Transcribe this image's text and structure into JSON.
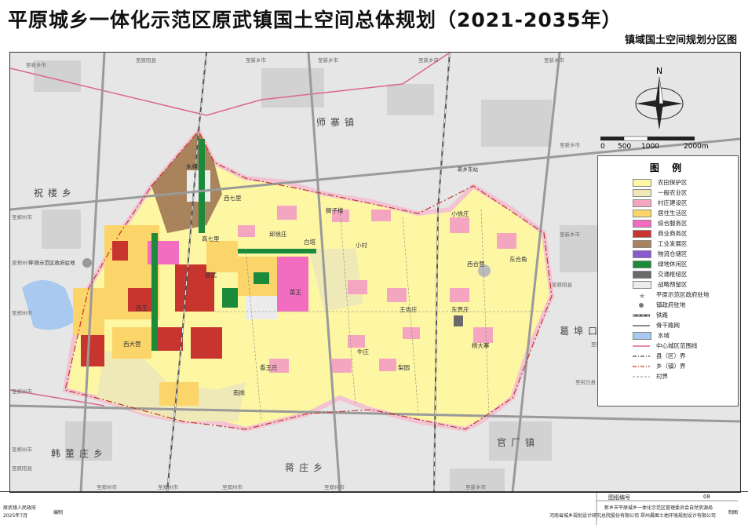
{
  "title": "平原城乡一体化示范区原武镇国土空间总体规划（2021-2035年）",
  "subtitle": "镇域国土空间规划分区图",
  "north_label": "N",
  "scale": {
    "ticks": [
      "0",
      "500",
      "1000",
      "2000m"
    ]
  },
  "legend": {
    "title": "图 例",
    "items": [
      {
        "label": "农田保护区",
        "color": "#fdf6a3",
        "kind": "fill"
      },
      {
        "label": "一般农业区",
        "color": "#efe9b8",
        "kind": "fill"
      },
      {
        "label": "村庄建设区",
        "color": "#f4a6c0",
        "kind": "fill"
      },
      {
        "label": "居住生活区",
        "color": "#fbd46a",
        "kind": "fill"
      },
      {
        "label": "综合服务区",
        "color": "#f26dbf",
        "kind": "fill"
      },
      {
        "label": "商业商务区",
        "color": "#c8342e",
        "kind": "fill"
      },
      {
        "label": "工业发展区",
        "color": "#a8835c",
        "kind": "fill"
      },
      {
        "label": "物流仓储区",
        "color": "#8a5ad0",
        "kind": "fill"
      },
      {
        "label": "绿地休闲区",
        "color": "#1b8a3a",
        "kind": "fill"
      },
      {
        "label": "交通枢纽区",
        "color": "#6a6a6a",
        "kind": "fill"
      },
      {
        "label": "战略预留区",
        "color": "#ececec",
        "kind": "fill"
      },
      {
        "label": "平原示范区政府驻地",
        "color": "#999999",
        "kind": "star"
      },
      {
        "label": "镇政府驻地",
        "color": "#777777",
        "kind": "dot"
      },
      {
        "label": "铁路",
        "color": "#555555",
        "kind": "rail"
      },
      {
        "label": "骨干路网",
        "color": "#888888",
        "kind": "road"
      },
      {
        "label": "水域",
        "color": "#a9c9ee",
        "kind": "fill"
      },
      {
        "label": "中心城区范围线",
        "color": "#d9668f",
        "kind": "line"
      },
      {
        "label": "县（区）界",
        "color": "#444444",
        "kind": "dashdot"
      },
      {
        "label": "乡（镇）界",
        "color": "#c0392b",
        "kind": "dashdot"
      },
      {
        "label": "村界",
        "color": "#666666",
        "kind": "dash"
      }
    ]
  },
  "map_labels": {
    "shizhai": "师寨镇",
    "zhulou": "祝楼乡",
    "gebukou": "葛埠口乡",
    "hanzhuang": "韩董庄乡",
    "jiangzhuang": "蒋庄乡",
    "guanchang": "官厂镇",
    "xiaoxuzhuang": "小徐庄",
    "xiheying": "西合营",
    "donghejiao": "东合角",
    "yangdazhai": "杨大寨",
    "dongguzhuang": "东贾庄",
    "wangxingzhuang": "王杏庄",
    "niuzhuang": "牛庄",
    "liyuan": "梨园",
    "xiangwangzhuang": "香王庄",
    "nanfan": "南岗",
    "caiwang": "菜王",
    "baita": "白塔",
    "xiaocun": "小村",
    "shizizhuang": "狮子楼",
    "xixuzhuang": "邱徐庄",
    "xiqili": "西七里",
    "gaoqili": "高七里",
    "yuanwu": "原武",
    "xiwang": "西王",
    "xidaying": "西大营",
    "zhulouzhen": "朱楼",
    "pingyuan_gov": "平原示范区政府驻地",
    "to_xinxiang_1": "至新乡市",
    "to_xinxiang_2": "至新乡市",
    "to_zhengzhou_1": "至郑州市",
    "to_zhengzhou_2": "至郑州市",
    "to_zhengzhou_3": "至郑州市",
    "to_zhengzhou_4": "至郑州市",
    "to_zhengzhou_5": "至郑州市",
    "to_zhengzhou_6": "至郑州市",
    "to_zhengzhou_7": "至郑州市",
    "to_xinxiang_3": "至新乡市",
    "to_xinxiang_4": "至新乡市",
    "to_xinxiang_5": "至新乡市",
    "to_fengqiu": "至封丘县",
    "to_yuanyang": "至原阳县",
    "to_xinxiang_6": "至新乡市",
    "to_xinxiang_7": "至新乡市",
    "xinxiang_east_station": "新乡东站",
    "to_yangjiazhuang": "至原阳县",
    "to_yuanyang_2": "至原阳县",
    "to_yuanyang_3": "至原阳县",
    "to_xinxiang_south": "至新乡市",
    "to_zhengzhou_8": "至郑州市",
    "to_zhengzhou_9": "至郑州市"
  },
  "footer": {
    "drawing_no_label": "图纸编号",
    "drawing_no": "08",
    "left1": "原武镇人民政府",
    "left2": "2025年7月",
    "editor_label": "编制",
    "org1": "新乡市平原城乡一体化示范区管理委员会自然资源局",
    "org2": "河南省城乡规划设计研究总院股份有限公司  郑州晨图土地环境规划设计有限公司",
    "right": "制图"
  }
}
